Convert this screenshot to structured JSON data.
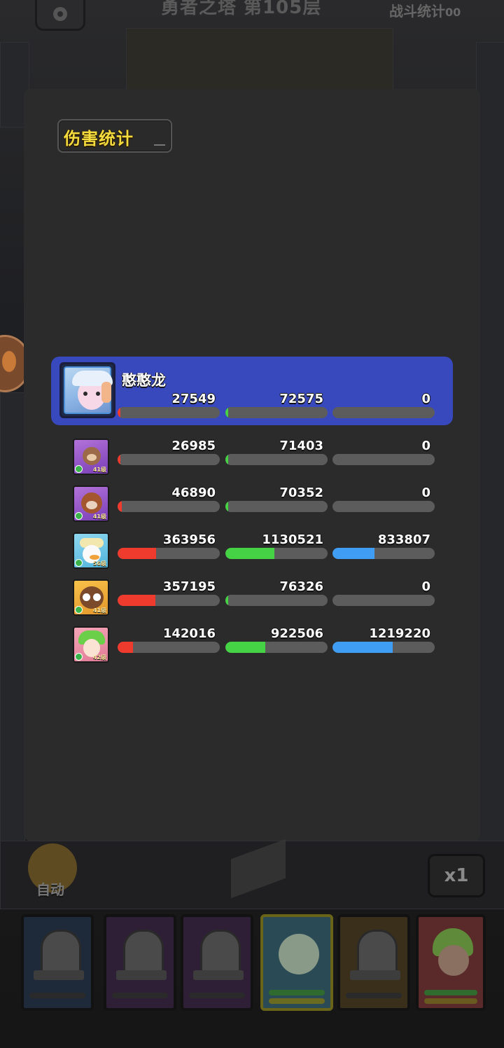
{
  "header": {
    "title": "勇者之塔 第105层",
    "stats_button_label": "战斗统计",
    "stats_button_suffix": "00"
  },
  "modal": {
    "title": "伤害统计",
    "rows": [
      {
        "name": "憨憨龙",
        "highlighted": true,
        "values": [
          "27549",
          "72575",
          "0"
        ],
        "fill": [
          0.03,
          0.03,
          0.0
        ]
      },
      {
        "level": "41级",
        "values": [
          "26985",
          "71403",
          "0"
        ],
        "fill": [
          0.03,
          0.03,
          0.0
        ]
      },
      {
        "level": "41级",
        "values": [
          "46890",
          "70352",
          "0"
        ],
        "fill": [
          0.04,
          0.03,
          0.0
        ]
      },
      {
        "level": "56级",
        "values": [
          "363956",
          "1130521",
          "833807"
        ],
        "fill": [
          0.38,
          0.48,
          0.41
        ]
      },
      {
        "level": "41级",
        "values": [
          "357195",
          "76326",
          "0"
        ],
        "fill": [
          0.37,
          0.03,
          0.0
        ]
      },
      {
        "level": "42级",
        "values": [
          "142016",
          "922506",
          "1219220"
        ],
        "fill": [
          0.15,
          0.39,
          0.59
        ]
      }
    ],
    "bar_colors": [
      "#ef3a2e",
      "#45d244",
      "#3f9df4"
    ]
  },
  "hud": {
    "auto_label": "自动",
    "speed_label": "x1"
  }
}
